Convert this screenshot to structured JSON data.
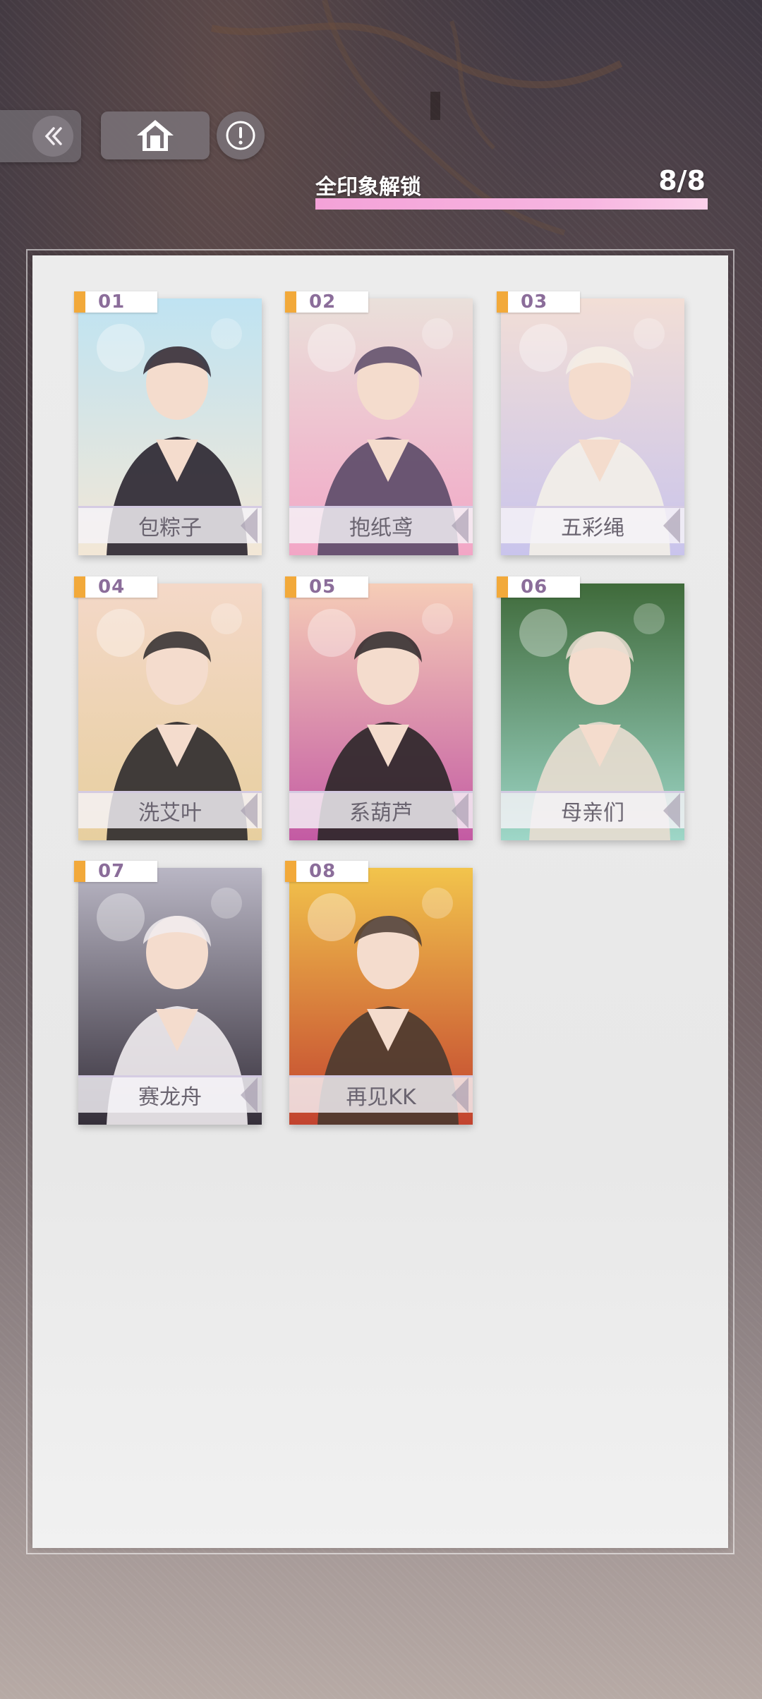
{
  "header": {
    "back_icon": "double-chevron-left-icon",
    "home_icon": "home-icon",
    "info_icon": "info-icon"
  },
  "progress": {
    "title": "全印象解锁",
    "count": "8/8",
    "fraction": 1.0,
    "fill_color": "#f4a2d8"
  },
  "cards": [
    {
      "number": "01",
      "label": "包粽子",
      "palette": [
        "#bfe3f2",
        "#f3e7d6",
        "#2a2530"
      ]
    },
    {
      "number": "02",
      "label": "抱纸鸢",
      "palette": [
        "#eae0da",
        "#f2a6c6",
        "#5b4a68"
      ]
    },
    {
      "number": "03",
      "label": "五彩绳",
      "palette": [
        "#f2ded6",
        "#c9c4ec",
        "#f3efe8"
      ]
    },
    {
      "number": "04",
      "label": "洗艾叶",
      "palette": [
        "#f4d8c8",
        "#e7cf9f",
        "#2e2a2c"
      ]
    },
    {
      "number": "05",
      "label": "系葫芦",
      "palette": [
        "#f6cdb7",
        "#c35aa3",
        "#2b2628"
      ]
    },
    {
      "number": "06",
      "label": "母亲们",
      "palette": [
        "#3f6a3a",
        "#9ed7c8",
        "#e8ddd0"
      ]
    },
    {
      "number": "07",
      "label": "赛龙舟",
      "palette": [
        "#b9b6c4",
        "#352f3a",
        "#f1ecef"
      ]
    },
    {
      "number": "08",
      "label": "再见KK",
      "palette": [
        "#f2c44c",
        "#c2432f",
        "#4a3a30"
      ]
    }
  ]
}
